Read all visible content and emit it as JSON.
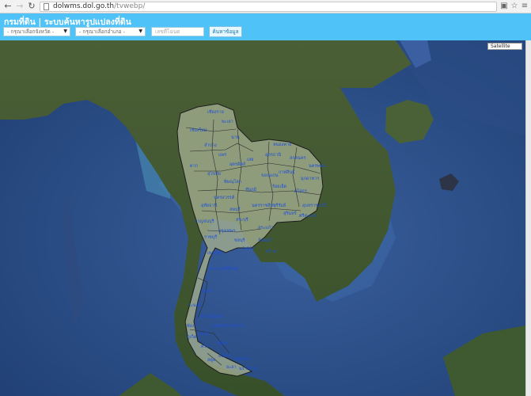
{
  "browser": {
    "url_host": "dolwms.dol.go.th",
    "url_path": "/tvwebp/"
  },
  "header": {
    "title": "กรมที่ดิน | ระบบค้นหารูปแปลงที่ดิน",
    "province_select": "- กรุณาเลือกจังหวัด -",
    "district_select": "- กรุณาเลือกอำเภอ -",
    "parcel_placeholder": "เลขที่โฉนด",
    "search_button": "ค้นหาข้อมูล"
  },
  "map": {
    "map_type": "Satellite",
    "province_labels": [
      "เชียงราย",
      "เชียงใหม่",
      "พะเยา",
      "น่าน",
      "ลำปาง",
      "แพร่",
      "อุตรดิตถ์",
      "ตาก",
      "สุโขทัย",
      "พิษณุโลก",
      "เลย",
      "หนองคาย",
      "อุดรธานี",
      "สกลนคร",
      "นครพนม",
      "ขอนแก่น",
      "กาฬสินธุ์",
      "มุกดาหาร",
      "ร้อยเอ็ด",
      "ยโสธร",
      "อุบลราชธานี",
      "ชัยภูมิ",
      "นครราชสีมา",
      "บุรีรัมย์",
      "สุรินทร์",
      "ศรีสะเกษ",
      "นครสวรรค์",
      "อุทัยธานี",
      "กาญจนบุรี",
      "ลพบุรี",
      "สระบุรี",
      "กรุงเทพฯ",
      "ชลบุรี",
      "ระยอง",
      "จันทบุรี",
      "ตราด",
      "สระแก้ว",
      "ราชบุรี",
      "เพชรบุรี",
      "ประจวบคีรีขันธ์",
      "ชุมพร",
      "ระนอง",
      "สุราษฎร์ธานี",
      "พังงา",
      "ภูเก็ต",
      "กระบี่",
      "นครศรีธรรมราช",
      "ตรัง",
      "พัทลุง",
      "สงขลา",
      "สตูล",
      "ปัตตานี",
      "ยะลา",
      "นราธิวาส"
    ]
  }
}
